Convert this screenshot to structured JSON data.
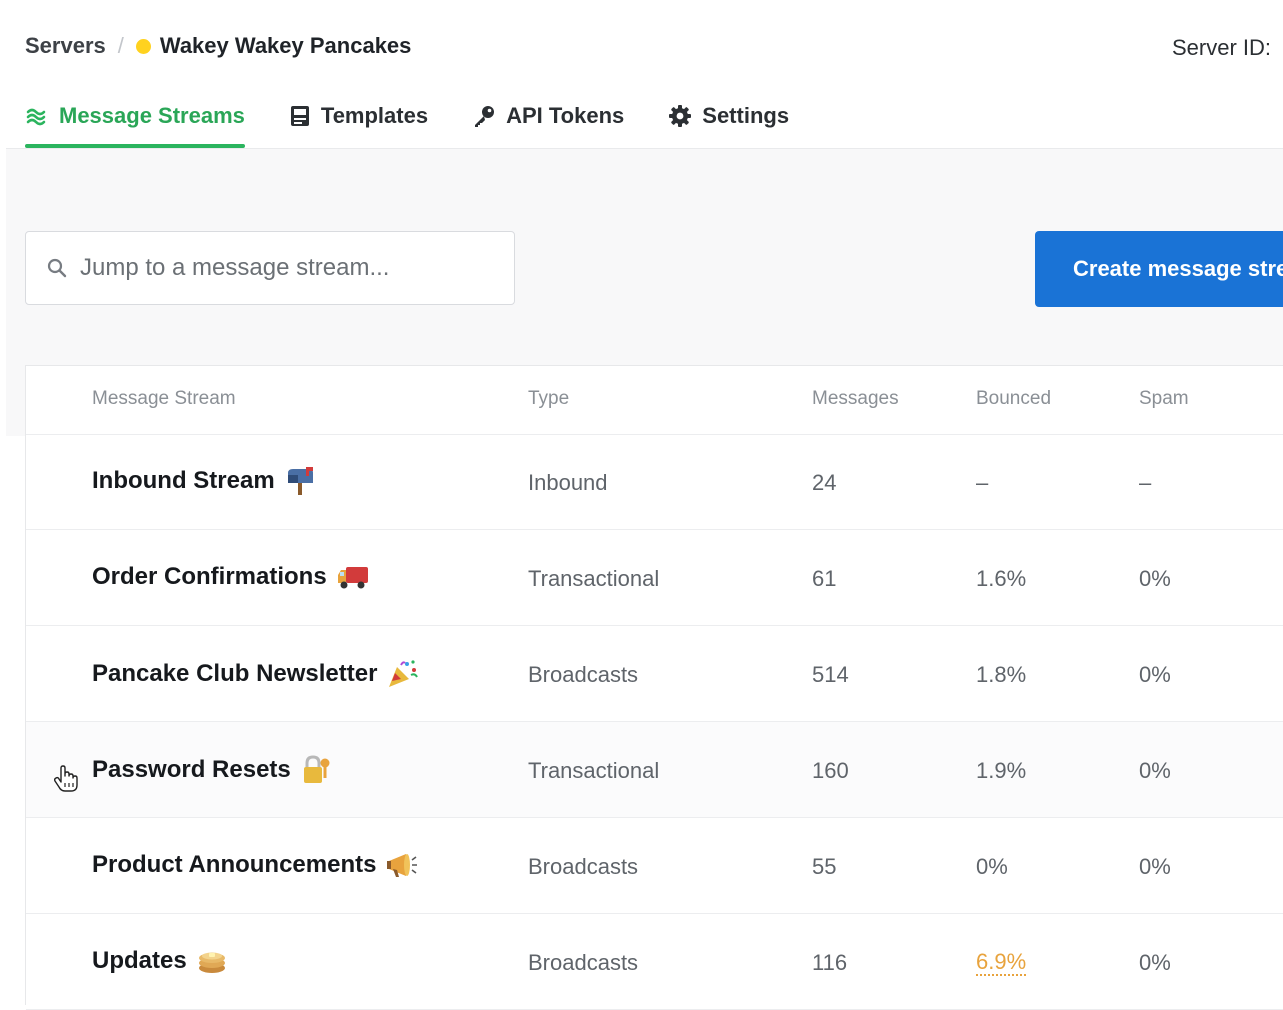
{
  "breadcrumb": {
    "servers_label": "Servers",
    "separator": "/",
    "server_name": "Wakey Wakey Pancakes",
    "status_color": "#ffd21f"
  },
  "server_id_label": "Server ID:",
  "tabs": [
    {
      "label": "Message Streams",
      "icon": "streams-icon",
      "active": true
    },
    {
      "label": "Templates",
      "icon": "template-icon",
      "active": false
    },
    {
      "label": "API Tokens",
      "icon": "key-icon",
      "active": false
    },
    {
      "label": "Settings",
      "icon": "gear-icon",
      "active": false
    }
  ],
  "search": {
    "placeholder": "Jump to a message stream..."
  },
  "create_button": {
    "label": "Create message stream"
  },
  "table": {
    "headers": [
      "Message Stream",
      "Type",
      "Messages",
      "Bounced",
      "Spam"
    ],
    "rows": [
      {
        "name": "Inbound Stream",
        "emoji": "mailbox-icon",
        "type": "Inbound",
        "messages": "24",
        "bounced": "–",
        "spam": "–"
      },
      {
        "name": "Order Confirmations",
        "emoji": "delivery-truck-icon",
        "type": "Transactional",
        "messages": "61",
        "bounced": "1.6%",
        "spam": "0%"
      },
      {
        "name": "Pancake Club Newsletter",
        "emoji": "party-popper-icon",
        "type": "Broadcasts",
        "messages": "514",
        "bounced": "1.8%",
        "spam": "0%"
      },
      {
        "name": "Password Resets",
        "emoji": "locked-with-key-icon",
        "type": "Transactional",
        "messages": "160",
        "bounced": "1.9%",
        "spam": "0%"
      },
      {
        "name": "Product Announcements",
        "emoji": "megaphone-icon",
        "type": "Broadcasts",
        "messages": "55",
        "bounced": "0%",
        "spam": "0%"
      },
      {
        "name": "Updates",
        "emoji": "pancakes-icon",
        "type": "Broadcasts",
        "messages": "116",
        "bounced": "6.9%",
        "spam": "0%"
      }
    ]
  },
  "colors": {
    "accent_green": "#2aa657",
    "primary_blue": "#1a73d6",
    "warning_orange": "#e8a33d"
  }
}
